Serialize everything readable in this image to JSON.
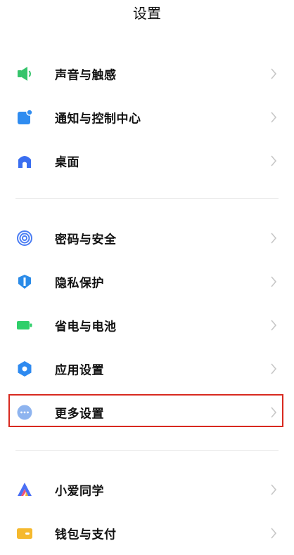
{
  "header": {
    "title": "设置"
  },
  "groups": [
    {
      "items": [
        {
          "label": "声音与触感",
          "icon": "speaker-icon",
          "color": "#35c46b"
        },
        {
          "label": "通知与控制中心",
          "icon": "notification-icon",
          "color": "#2f8cf0"
        },
        {
          "label": "桌面",
          "icon": "home-icon",
          "color": "#3a6ef0"
        }
      ]
    },
    {
      "items": [
        {
          "label": "密码与安全",
          "icon": "fingerprint-icon",
          "color": "#4b7df3"
        },
        {
          "label": "隐私保护",
          "icon": "privacy-shield-icon",
          "color": "#2a8be8"
        },
        {
          "label": "省电与电池",
          "icon": "battery-icon",
          "color": "#2fcf6a"
        },
        {
          "label": "应用设置",
          "icon": "gear-icon",
          "color": "#2e8af0"
        },
        {
          "label": "更多设置",
          "icon": "more-dots-icon",
          "color": "#8eb4ef"
        }
      ]
    },
    {
      "items": [
        {
          "label": "小爱同学",
          "icon": "xiaoai-icon",
          "color": "#4a6ff5"
        },
        {
          "label": "钱包与支付",
          "icon": "wallet-icon",
          "color": "#f5b92e"
        }
      ]
    }
  ],
  "colors": {
    "highlight_border": "#d8291f",
    "chevron": "#c7c7c7",
    "divider": "#ececec"
  }
}
